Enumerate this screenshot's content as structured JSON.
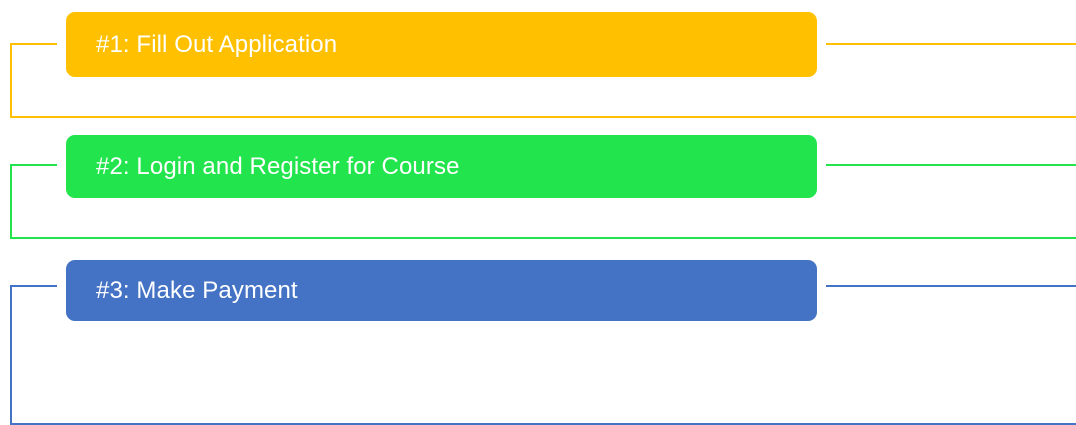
{
  "steps": [
    {
      "label": "#1: Fill Out Application",
      "color": "#FFC000"
    },
    {
      "label": "#2: Login and Register for Course",
      "color": "#22E44C"
    },
    {
      "label": "#3: Make Payment",
      "color": "#4472C4"
    }
  ]
}
